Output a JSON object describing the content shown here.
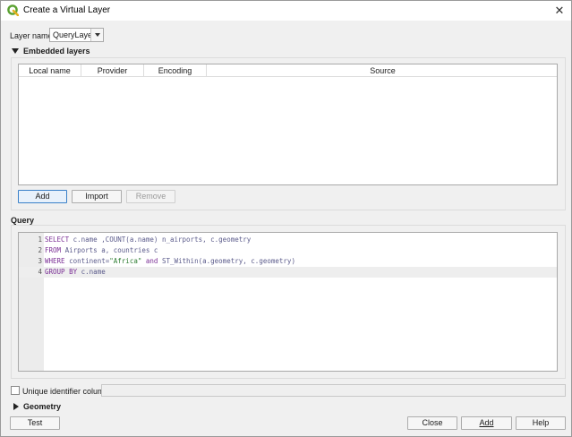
{
  "window": {
    "title": "Create a Virtual Layer",
    "close_glyph": "✕"
  },
  "layer_name": {
    "label": "Layer name",
    "value": "QueryLayer"
  },
  "embedded": {
    "header": "Embedded layers",
    "columns": [
      "Local name",
      "Provider",
      "Encoding",
      "Source"
    ],
    "buttons": {
      "add": "Add",
      "import": "Import",
      "remove": "Remove"
    }
  },
  "query": {
    "header": "Query",
    "lines": [
      {
        "num": "1",
        "tokens": [
          {
            "t": "SELECT",
            "c": "kw"
          },
          {
            "t": " c.name ,COUNT(a.name) n_airports, c.geometry",
            "c": "id"
          }
        ]
      },
      {
        "num": "2",
        "tokens": [
          {
            "t": "FROM",
            "c": "kw"
          },
          {
            "t": " Airports a, countries c",
            "c": "id"
          }
        ]
      },
      {
        "num": "3",
        "tokens": [
          {
            "t": "WHERE",
            "c": "kw"
          },
          {
            "t": " continent=",
            "c": "id"
          },
          {
            "t": "\"Africa\"",
            "c": "str"
          },
          {
            "t": " ",
            "c": "id"
          },
          {
            "t": "and",
            "c": "kw"
          },
          {
            "t": " ST_Within(a.geometry, c.geometry)",
            "c": "id"
          }
        ]
      },
      {
        "num": "4",
        "tokens": [
          {
            "t": "GROUP BY",
            "c": "kw"
          },
          {
            "t": " c.name",
            "c": "id"
          }
        ]
      }
    ]
  },
  "unique_id": {
    "label": "Unique identifier column",
    "checked": false,
    "value": ""
  },
  "geometry": {
    "header": "Geometry"
  },
  "footer": {
    "test": "Test",
    "close": "Close",
    "add": "Add",
    "help": "Help"
  }
}
